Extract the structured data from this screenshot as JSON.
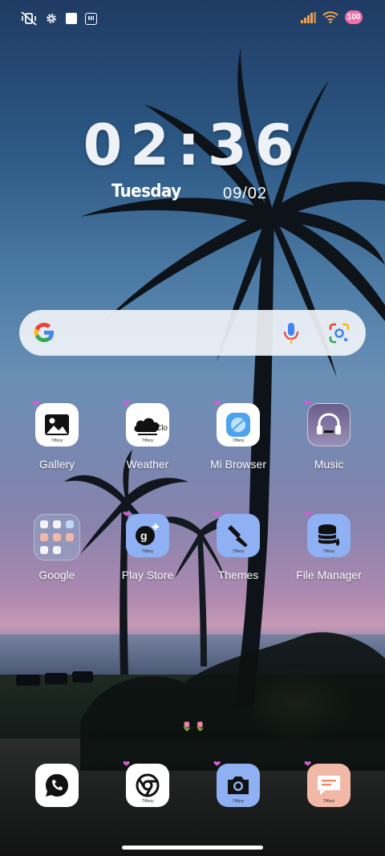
{
  "status_bar": {
    "left_icons": [
      "vibrate-off-icon",
      "gear-icon",
      "square-notification-icon",
      "mi-icon"
    ],
    "mi_text": "MI",
    "right_icons": [
      "signal-icon",
      "wifi-icon",
      "battery-icon"
    ],
    "battery": "100"
  },
  "clock": {
    "time": "02:36",
    "day": "Tuesday",
    "date": "09/02"
  },
  "search_bar": {
    "icons": [
      "google-g-icon",
      "microphone-icon",
      "google-lens-icon"
    ],
    "logo": "G"
  },
  "apps": {
    "row1": [
      {
        "label": "Gallery",
        "icon": "gallery-icon"
      },
      {
        "label": "Weather",
        "icon": "weather-icon"
      },
      {
        "label": "Mi Browser",
        "icon": "browser-icon"
      },
      {
        "label": "Music",
        "icon": "headphones-icon"
      }
    ],
    "row2": [
      {
        "label": "Google",
        "icon": "folder-icon"
      },
      {
        "label": "Play Store",
        "icon": "google-plus-icon"
      },
      {
        "label": "Themes",
        "icon": "brush-icon"
      },
      {
        "label": "File Manager",
        "icon": "database-icon"
      }
    ]
  },
  "dock": [
    {
      "icon": "whatsapp-icon"
    },
    {
      "icon": "chrome-icon"
    },
    {
      "icon": "camera-icon"
    },
    {
      "icon": "messages-icon"
    }
  ],
  "icon_tag": "Tiffany",
  "weather_icon_text": "Clo",
  "colors": {
    "icon_blue": "#8fb0f2",
    "icon_peach": "#f2b8a7",
    "heart": "#d55bd8",
    "battery": "#f06ea8"
  }
}
